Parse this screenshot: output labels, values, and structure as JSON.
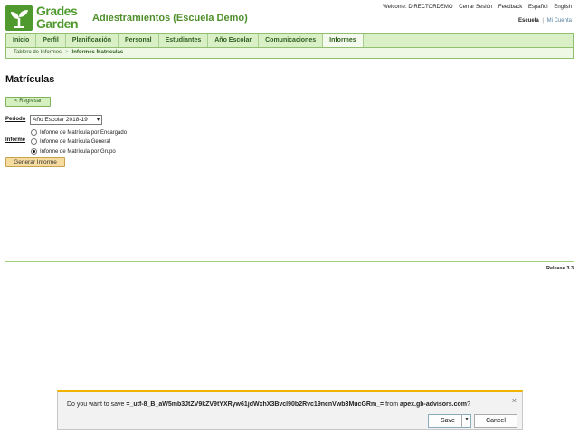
{
  "header": {
    "logo_line1": "Grades",
    "logo_line2": "Garden",
    "school_title": "Adiestramientos (Escuela Demo)",
    "welcome": "Welcome: DIRECTORDEMO",
    "logout": "Cerrar Sesión",
    "feedback": "Feedback",
    "lang_es": "Español",
    "lang_en": "English",
    "scope_active": "Escuela",
    "scope_separator": "|",
    "scope_other": "Mi Cuenta"
  },
  "nav": {
    "items": [
      {
        "label": "Inicio"
      },
      {
        "label": "Perfil"
      },
      {
        "label": "Planificación"
      },
      {
        "label": "Personal"
      },
      {
        "label": "Estudiantes"
      },
      {
        "label": "Año Escolar"
      },
      {
        "label": "Comunicaciones"
      },
      {
        "label": "Informes"
      }
    ]
  },
  "breadcrumb": {
    "parent": "Tablero de Informes",
    "separator": ">",
    "current": "Informes Matrículas"
  },
  "page": {
    "title": "Matrículas",
    "back_button": "< Regresar",
    "period_label": "Periodo",
    "period_value": "Año Escolar 2018-19",
    "report_label": "Informe",
    "options": [
      {
        "label": "Informe de Matrícula por Encargado",
        "checked": false
      },
      {
        "label": "Informe de Matrícula General",
        "checked": false
      },
      {
        "label": "Informe de Matrícula por Grupo",
        "checked": true
      }
    ],
    "generate_button": "Generar Informe",
    "release": "Release 3.3"
  },
  "download_bar": {
    "prompt_prefix": "Do you want to save ",
    "filename": "=_utf-8_B_aW5mb3JtZV9kZV9tYXRyw61jdWxhX3Bvcl90b2Rvc19ncnVwb3MucGRm_=",
    "prompt_middle": " from ",
    "domain": "apex.gb-advisors.com",
    "prompt_suffix": "?",
    "close_glyph": "×",
    "save_label": "Save",
    "save_arrow": "▾",
    "cancel_label": "Cancel"
  },
  "colors": {
    "brand_green": "#4f9a2f",
    "nav_bg": "#d9efc6",
    "generate_bg": "#f7dca0",
    "dialog_accent": "#f0b400"
  }
}
